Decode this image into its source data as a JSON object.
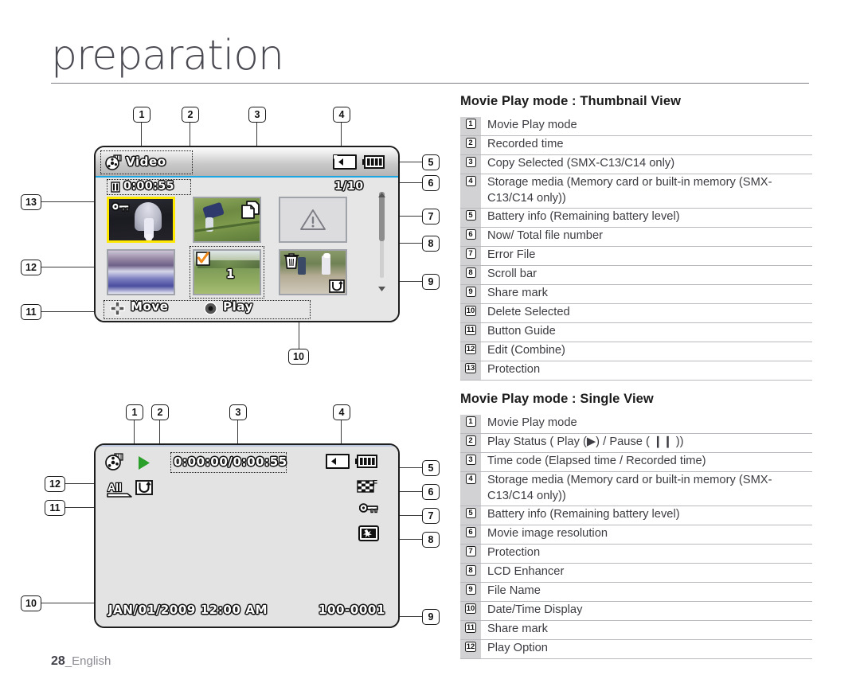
{
  "page": {
    "title": "preparation",
    "footer_page": "28",
    "footer_lang": "_English"
  },
  "sections": [
    {
      "heading": "Movie Play mode : Thumbnail View",
      "items": [
        {
          "n": "1",
          "text": "Movie Play mode"
        },
        {
          "n": "2",
          "text": "Recorded time"
        },
        {
          "n": "3",
          "text": "Copy Selected (SMX-C13/C14 only)"
        },
        {
          "n": "4",
          "text": "Storage media (Memory card or built-in memory (SMX-C13/C14 only))"
        },
        {
          "n": "5",
          "text": "Battery info (Remaining battery level)"
        },
        {
          "n": "6",
          "text": "Now/ Total file number"
        },
        {
          "n": "7",
          "text": "Error File"
        },
        {
          "n": "8",
          "text": "Scroll bar"
        },
        {
          "n": "9",
          "text": "Share mark"
        },
        {
          "n": "10",
          "text": "Delete Selected"
        },
        {
          "n": "11",
          "text": "Button Guide"
        },
        {
          "n": "12",
          "text": "Edit (Combine)"
        },
        {
          "n": "13",
          "text": "Protection"
        }
      ]
    },
    {
      "heading": "Movie Play mode : Single View",
      "items": [
        {
          "n": "1",
          "text": "Movie Play mode"
        },
        {
          "n": "2",
          "text": "Play Status ( Play (▶) / Pause ( ❙❙ ))"
        },
        {
          "n": "3",
          "text": "Time code (Elapsed time / Recorded time)"
        },
        {
          "n": "4",
          "text": "Storage media (Memory card or built-in memory (SMX-C13/C14 only))"
        },
        {
          "n": "5",
          "text": "Battery info (Remaining battery level)"
        },
        {
          "n": "6",
          "text": "Movie image resolution"
        },
        {
          "n": "7",
          "text": "Protection"
        },
        {
          "n": "8",
          "text": "LCD Enhancer"
        },
        {
          "n": "9",
          "text": "File Name"
        },
        {
          "n": "10",
          "text": "Date/Time Display"
        },
        {
          "n": "11",
          "text": "Share mark"
        },
        {
          "n": "12",
          "text": "Play Option"
        }
      ]
    }
  ],
  "thumbnail_view": {
    "mode_label": "Video",
    "recorded_time": "0:00:55",
    "file_counter": "1/10",
    "edit_combine_number": "1",
    "guide_move": "Move",
    "guide_play": "Play",
    "icons": {
      "mode": "film-reel-icon",
      "recorded_time": "film-strip-icon",
      "storage_media": "memory-card-icon",
      "battery": "battery-icon",
      "protection": "key-icon",
      "copy_selected": "copy-pages-icon",
      "error_file": "warning-triangle-icon",
      "edit_combine": "orange-check-icon",
      "delete_selected": "trash-icon",
      "share_mark": "share-mark-icon",
      "scroll_bar": "scroll-bar"
    },
    "callouts": [
      "1",
      "2",
      "3",
      "4",
      "5",
      "6",
      "7",
      "8",
      "9",
      "10",
      "11",
      "12",
      "13"
    ]
  },
  "single_view": {
    "time_code": "0:00:00/0:00:55",
    "datetime": "JAN/01/2009 12:00 AM",
    "file_name": "100-0001",
    "play_option_label": "All",
    "icons": {
      "mode": "film-reel-icon",
      "play_status": "play-triangle-icon",
      "storage_media": "memory-card-icon",
      "battery": "battery-icon",
      "resolution": "checkered-flag-icon",
      "protection": "key-icon",
      "lcd_enhancer": "lcd-enhancer-icon",
      "share_mark": "share-mark-icon",
      "play_option": "all-play-option-icon"
    },
    "callouts": [
      "1",
      "2",
      "3",
      "4",
      "5",
      "6",
      "7",
      "8",
      "9",
      "10",
      "11",
      "12"
    ]
  },
  "colors": {
    "accent_blue": "#1aa6e2",
    "selection_yellow": "#ffe800",
    "play_green": "#2aa02a",
    "edit_orange": "#f08a1c",
    "legend_num_bg": "#d2d2d4"
  }
}
